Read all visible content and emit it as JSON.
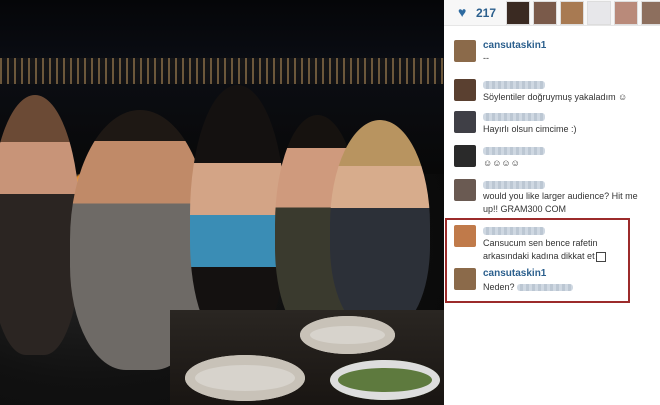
{
  "photo": {
    "description_icon": "group-photo"
  },
  "likes": {
    "count": "217",
    "icon": "heart-icon",
    "liker_colors": [
      "#5a4a44",
      "#7a5a4a",
      "#a87a52",
      "#6b6f75",
      "#e7e7ea",
      "#b98a7a",
      "#8d6f5e"
    ]
  },
  "comments": [
    {
      "user": "cansutaskin1",
      "text": "--",
      "avatar_color": "#8b6a4a",
      "time": ""
    },
    {
      "user": "",
      "text": "Söylentiler doğruymuş yakaladım ☺",
      "avatar_color": "#5a4030",
      "time": ""
    },
    {
      "user": "",
      "text": "Hayırlı olsun cimcime :)",
      "avatar_color": "#3f3f46",
      "time": ""
    },
    {
      "user": "",
      "text": "☺☺☺☺",
      "avatar_color": "#2a2a2a",
      "time": ""
    },
    {
      "user": "",
      "text": "would you like larger audience? Hit me up!! GRAM300 COM",
      "avatar_color": "#6a5a52",
      "time": ""
    },
    {
      "user": "",
      "text": "Cansucum sen bence rafetin arkasındaki kadına dikkat et",
      "avatar_color": "#c07a4a",
      "time": ""
    },
    {
      "user": "cansutaskin1",
      "text": "Neden?",
      "avatar_color": "#8b6a4a",
      "time": ""
    }
  ]
}
